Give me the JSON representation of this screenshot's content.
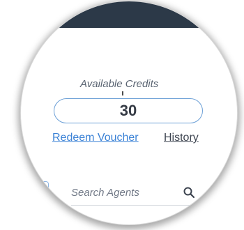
{
  "credits": {
    "label": "Available Credits",
    "value": "30"
  },
  "links": {
    "redeem": "Redeem Voucher",
    "history": "History"
  },
  "search": {
    "placeholder": "Search Agents",
    "icon": "search-icon"
  },
  "colors": {
    "topbar": "#2c3948",
    "accent": "#3b82d6",
    "box_border": "#6b9fd6"
  }
}
